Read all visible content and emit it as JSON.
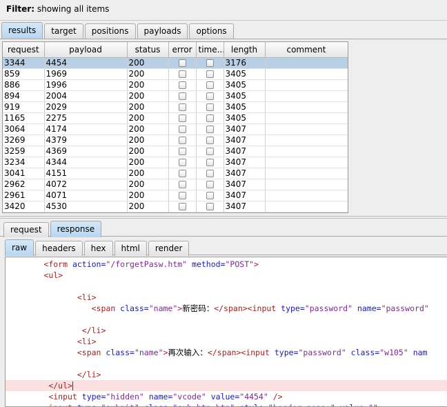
{
  "filter": {
    "label": "Filter:",
    "text": "showing all items"
  },
  "main_tabs": [
    {
      "label": "results",
      "active": true
    },
    {
      "label": "target",
      "active": false
    },
    {
      "label": "positions",
      "active": false
    },
    {
      "label": "payloads",
      "active": false
    },
    {
      "label": "options",
      "active": false
    }
  ],
  "table": {
    "columns": [
      "request",
      "payload",
      "status",
      "error",
      "time...",
      "length",
      "comment"
    ],
    "rows": [
      {
        "request": "3344",
        "payload": "4454",
        "status": "200",
        "length": "3176",
        "selected": true
      },
      {
        "request": "859",
        "payload": "1969",
        "status": "200",
        "length": "3405"
      },
      {
        "request": "886",
        "payload": "1996",
        "status": "200",
        "length": "3405"
      },
      {
        "request": "894",
        "payload": "2004",
        "status": "200",
        "length": "3405"
      },
      {
        "request": "919",
        "payload": "2029",
        "status": "200",
        "length": "3405"
      },
      {
        "request": "1165",
        "payload": "2275",
        "status": "200",
        "length": "3405"
      },
      {
        "request": "3064",
        "payload": "4174",
        "status": "200",
        "length": "3407"
      },
      {
        "request": "3269",
        "payload": "4379",
        "status": "200",
        "length": "3407"
      },
      {
        "request": "3259",
        "payload": "4369",
        "status": "200",
        "length": "3407"
      },
      {
        "request": "3234",
        "payload": "4344",
        "status": "200",
        "length": "3407"
      },
      {
        "request": "3041",
        "payload": "4151",
        "status": "200",
        "length": "3407"
      },
      {
        "request": "2962",
        "payload": "4072",
        "status": "200",
        "length": "3407"
      },
      {
        "request": "2961",
        "payload": "4071",
        "status": "200",
        "length": "3407"
      },
      {
        "request": "3420",
        "payload": "4530",
        "status": "200",
        "length": "3407"
      }
    ]
  },
  "req_tabs": [
    {
      "label": "request",
      "active": false
    },
    {
      "label": "response",
      "active": true
    }
  ],
  "view_tabs": [
    {
      "label": "raw",
      "active": true
    },
    {
      "label": "headers",
      "active": false
    },
    {
      "label": "hex",
      "active": false
    },
    {
      "label": "html",
      "active": false
    },
    {
      "label": "render",
      "active": false
    }
  ],
  "code_lines": [
    {
      "indent": "        ",
      "segments": [
        [
          "tag",
          "<form "
        ],
        [
          "attr",
          "action="
        ],
        [
          "val",
          "\"/forgetPasw.htm\""
        ],
        [
          "attr",
          " method="
        ],
        [
          "val",
          "\"POST\""
        ],
        [
          "tag",
          ">"
        ]
      ]
    },
    {
      "indent": "        ",
      "segments": [
        [
          "tag",
          "<ul>"
        ]
      ]
    },
    {
      "indent": "",
      "segments": []
    },
    {
      "indent": "               ",
      "segments": [
        [
          "tag",
          "<li>"
        ]
      ]
    },
    {
      "indent": "                  ",
      "segments": [
        [
          "tag",
          "<span "
        ],
        [
          "attr",
          "class="
        ],
        [
          "val",
          "\"name\""
        ],
        [
          "tag",
          ">"
        ],
        [
          "txt",
          "新密码："
        ],
        [
          "tag",
          "</span><input "
        ],
        [
          "attr",
          "type="
        ],
        [
          "val",
          "\"password\""
        ],
        [
          "attr",
          " name="
        ],
        [
          "val",
          "\"password\""
        ]
      ]
    },
    {
      "indent": "",
      "segments": []
    },
    {
      "indent": "                ",
      "segments": [
        [
          "tag",
          "</li>"
        ]
      ]
    },
    {
      "indent": "               ",
      "segments": [
        [
          "tag",
          "<li>"
        ]
      ]
    },
    {
      "indent": "               ",
      "segments": [
        [
          "tag",
          "<span "
        ],
        [
          "attr",
          "class="
        ],
        [
          "val",
          "\"name\""
        ],
        [
          "tag",
          ">"
        ],
        [
          "txt",
          "再次输入："
        ],
        [
          "tag",
          "</span><input "
        ],
        [
          "attr",
          "type="
        ],
        [
          "val",
          "\"password\""
        ],
        [
          "attr",
          " class="
        ],
        [
          "val",
          "\"w105\""
        ],
        [
          "attr",
          " nam"
        ]
      ]
    },
    {
      "indent": "",
      "segments": []
    },
    {
      "indent": "               ",
      "segments": [
        [
          "tag",
          "</li>"
        ]
      ]
    },
    {
      "indent": "         ",
      "segments": [
        [
          "tag",
          "</ul>"
        ]
      ],
      "current": true
    },
    {
      "indent": "         ",
      "segments": [
        [
          "tag",
          "<input "
        ],
        [
          "attr",
          "type="
        ],
        [
          "val",
          "\"hidden\""
        ],
        [
          "attr",
          " name="
        ],
        [
          "val",
          "\"vcode\""
        ],
        [
          "attr",
          " value="
        ],
        [
          "val",
          "\"4454\""
        ],
        [
          "tag",
          " />"
        ]
      ]
    },
    {
      "indent": "        ",
      "segments": [
        [
          "tag",
          "<input "
        ],
        [
          "attr",
          "type="
        ],
        [
          "val",
          "\"submit\""
        ],
        [
          "attr",
          " class="
        ],
        [
          "val",
          "\"sub_btn btn\""
        ],
        [
          "attr",
          " style="
        ],
        [
          "val",
          "\"border:none;\""
        ],
        [
          "attr",
          " value="
        ],
        [
          "val",
          "\"\""
        ],
        [
          "tag",
          ">"
        ]
      ]
    }
  ]
}
